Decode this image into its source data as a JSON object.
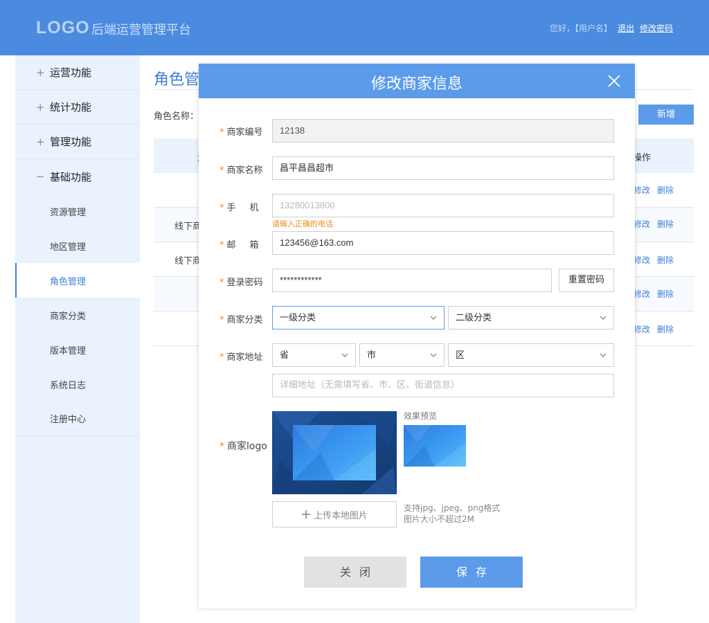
{
  "header": {
    "logo": "LOGO",
    "title": "后端运营管理平台",
    "greeting": "您好，【用户名】",
    "logout": "退出",
    "change_password": "修改密码"
  },
  "sidebar": {
    "groups": [
      {
        "label": "运营功能",
        "sign": "+"
      },
      {
        "label": "统计功能",
        "sign": "+"
      },
      {
        "label": "管理功能",
        "sign": "+"
      },
      {
        "label": "基础功能",
        "sign": "−"
      }
    ],
    "items": [
      "资源管理",
      "地区管理",
      "角色管理",
      "商家分类",
      "版本管理",
      "系统日志",
      "注册中心"
    ],
    "active_item": "角色管理"
  },
  "main": {
    "title": "角色管",
    "filter_label": "角色名称：",
    "add_button": "新增",
    "table": {
      "name_header": "角",
      "ops_header": "操作",
      "rows": [
        {
          "name": "",
          "edit": "修改",
          "delete": "删除"
        },
        {
          "name": "线下商",
          "edit": "修改",
          "delete": "删除"
        },
        {
          "name": "线下商",
          "edit": "修改",
          "delete": "删除"
        },
        {
          "name": "",
          "edit": "修改",
          "delete": "删除"
        },
        {
          "name": "",
          "edit": "修改",
          "delete": "删除"
        }
      ]
    }
  },
  "modal": {
    "title": "修改商家信息",
    "fields": {
      "id": {
        "label": "商家编号",
        "value": "12138"
      },
      "name": {
        "label": "商家名称",
        "value": "昌平昌昌超市"
      },
      "phone": {
        "label": "手机",
        "placeholder": "13280013800",
        "error": "请输入正确的电话"
      },
      "email": {
        "label": "邮箱",
        "value": "123456@163.com"
      },
      "password": {
        "label": "登录密码",
        "value": "************",
        "reset_button": "重置密码"
      },
      "category": {
        "label": "商家分类",
        "level1": "一级分类",
        "level2": "二级分类"
      },
      "address": {
        "label": "商家地址",
        "province": "省",
        "city": "市",
        "district": "区",
        "detail_placeholder": "详细地址（无需填写省、市、区、街道信息）"
      },
      "logo": {
        "label": "商家logo",
        "preview_label": "效果预览",
        "upload_button": "上传本地图片",
        "hint_line1": "支持jpg、jpeg、png格式",
        "hint_line2": "图片大小不超过2M"
      }
    },
    "close_button": "关闭",
    "save_button": "保存"
  },
  "colors": {
    "header_bg": "#4a8be0",
    "accent": "#5b9bea",
    "sidebar_bg": "#e9f2fd",
    "required_star": "#f08a1b"
  }
}
